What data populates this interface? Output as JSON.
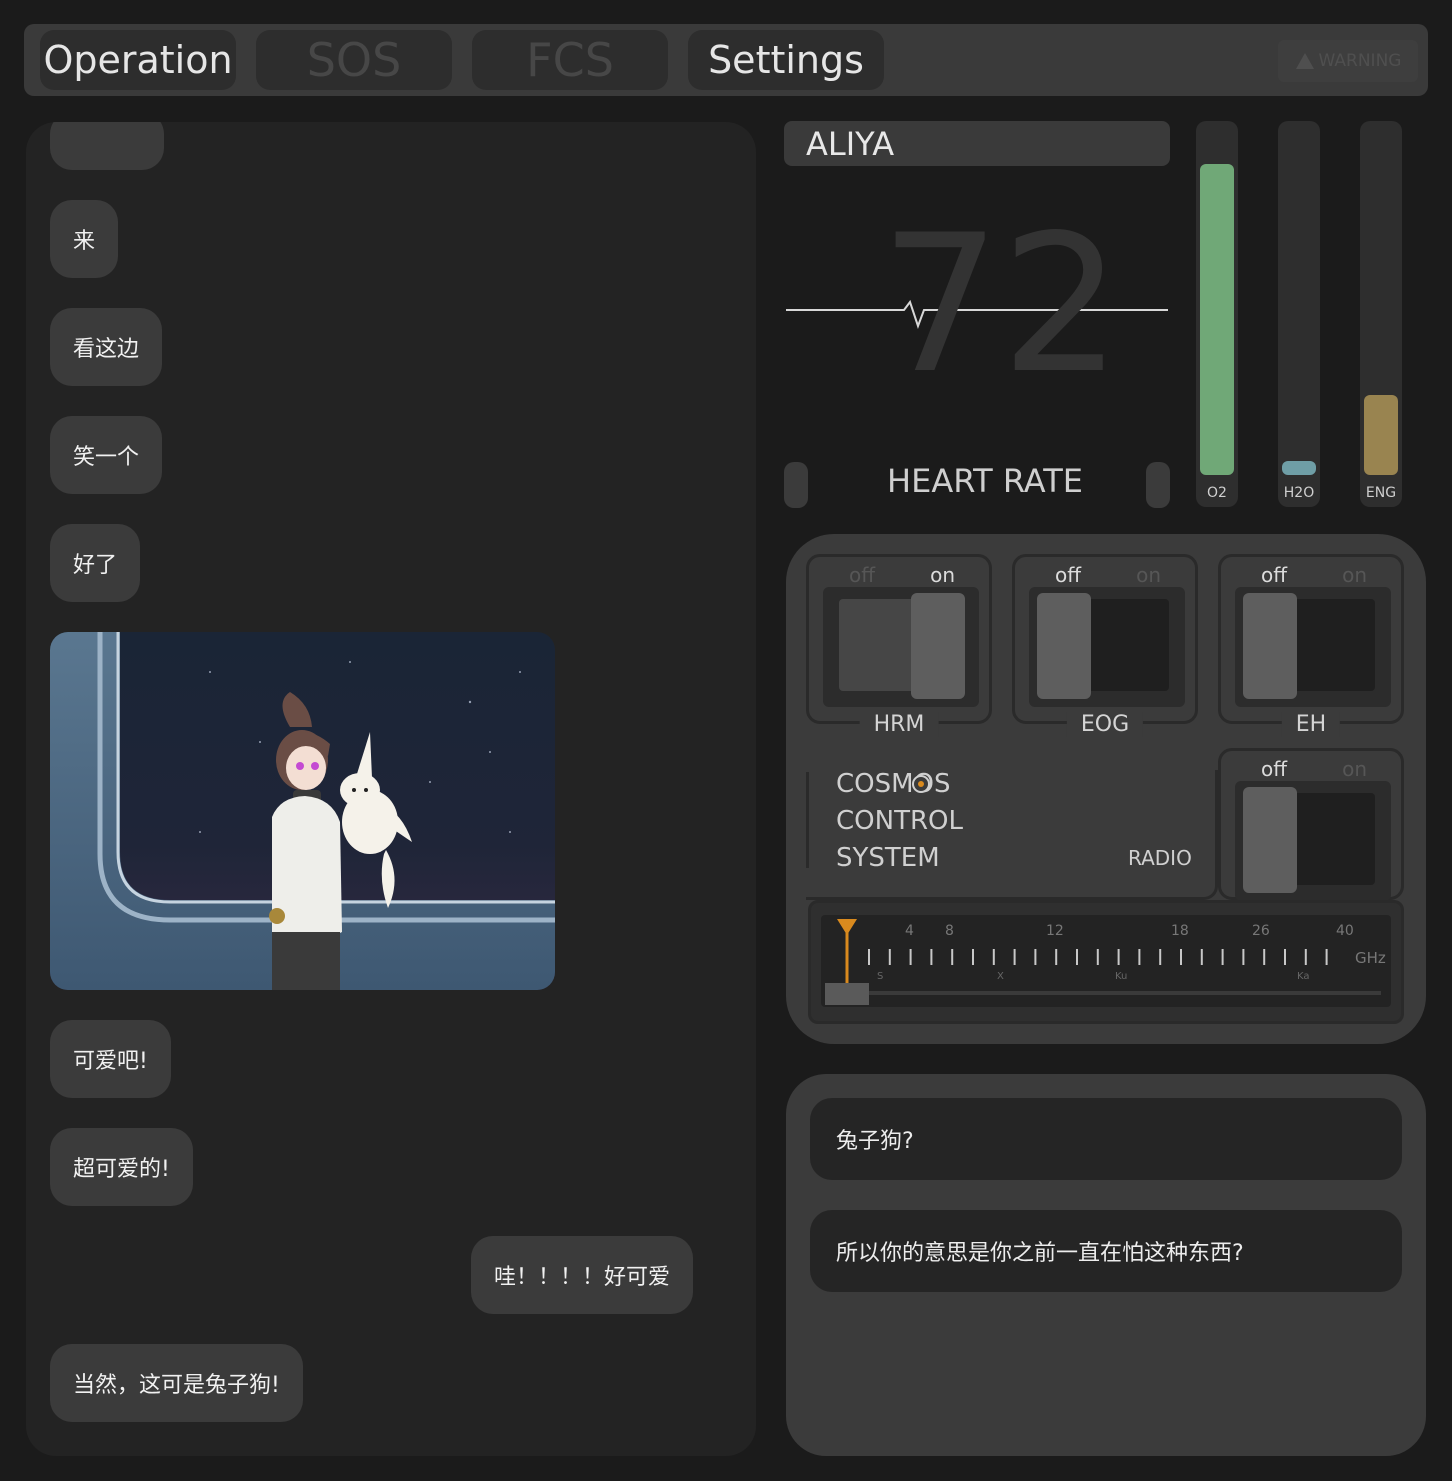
{
  "tabs": [
    {
      "label": "Operation",
      "state": "active"
    },
    {
      "label": "SOS",
      "state": "disabled"
    },
    {
      "label": "FCS",
      "state": "disabled"
    },
    {
      "label": "Settings",
      "state": "active"
    }
  ],
  "warning_badge": {
    "label": "WARNING",
    "icon": "warning-triangle-icon",
    "state": "disabled"
  },
  "chat": {
    "messages": [
      {
        "text": "来",
        "side": "left"
      },
      {
        "text": "看这边",
        "side": "left"
      },
      {
        "text": "笑一个",
        "side": "left"
      },
      {
        "text": "好了",
        "side": "left"
      },
      {
        "text": "可爱吧!",
        "side": "left"
      },
      {
        "text": "超可爱的!",
        "side": "left"
      },
      {
        "text": "哇！！！！好可爱",
        "side": "right"
      },
      {
        "text": "当然，这可是兔子狗!",
        "side": "left"
      }
    ]
  },
  "vitals": {
    "name": "ALIYA",
    "heart_rate": "72",
    "heart_rate_label": "HEART RATE",
    "gauges": [
      {
        "label": "O2",
        "level": 0.9,
        "color": "#70a877"
      },
      {
        "label": "H2O",
        "level": 0.04,
        "color": "#6f9ea6"
      },
      {
        "label": "ENG",
        "level": 0.23,
        "color": "#998450"
      }
    ]
  },
  "control": {
    "switches": [
      {
        "name": "HRM",
        "off": "off",
        "on": "on",
        "state": "on"
      },
      {
        "name": "EOG",
        "off": "off",
        "on": "on",
        "state": "off"
      },
      {
        "name": "EH",
        "off": "off",
        "on": "on",
        "state": "off"
      }
    ],
    "system_title": [
      "COSMOS",
      "CONTROL",
      "SYSTEM"
    ],
    "radio": {
      "label": "RADIO",
      "off": "off",
      "on": "on",
      "state": "off"
    },
    "tuner": {
      "freq_ticks": [
        "4",
        "8",
        "12",
        "18",
        "26",
        "40"
      ],
      "unit": "GHz",
      "bands": [
        "S",
        "X",
        "Ku",
        "Ka"
      ],
      "accent": "#d98a1e"
    }
  },
  "options": [
    "兔子狗?",
    "所以你的意思是你之前一直在怕这种东西?"
  ]
}
